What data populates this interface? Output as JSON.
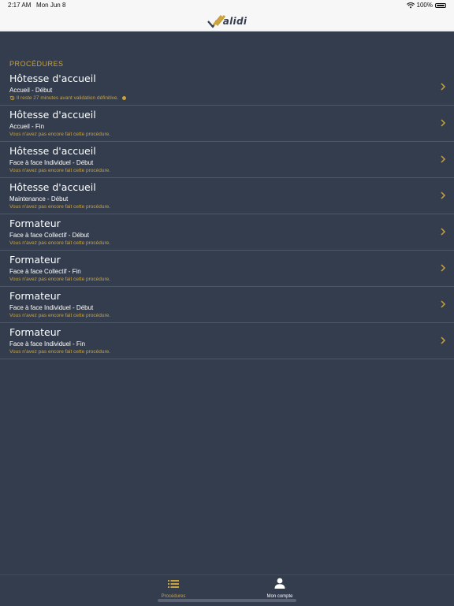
{
  "status_bar": {
    "time": "2:17 AM",
    "date": "Mon Jun 8",
    "battery": "100%"
  },
  "app": {
    "logo_text": "alidi"
  },
  "section_title": "PROCÉDURES",
  "procedures": [
    {
      "title": "Hôtesse d'accueil",
      "subtitle": "Accueil - Début",
      "status": "Il reste 27 minutes avant validation définitive."
    },
    {
      "title": "Hôtesse d'accueil",
      "subtitle": "Accueil - Fin",
      "status": "Vous n'avez pas encore fait cette procédure."
    },
    {
      "title": "Hôtesse d'accueil",
      "subtitle": "Face à face Individuel - Début",
      "status": "Vous n'avez pas encore fait cette procédure."
    },
    {
      "title": "Hôtesse d'accueil",
      "subtitle": "Maintenance - Début",
      "status": "Vous n'avez pas encore fait cette procédure."
    },
    {
      "title": "Formateur",
      "subtitle": "Face à face Collectif - Début",
      "status": "Vous n'avez pas encore fait cette procédure."
    },
    {
      "title": "Formateur",
      "subtitle": "Face à face Collectif - Fin",
      "status": "Vous n'avez pas encore fait cette procédure."
    },
    {
      "title": "Formateur",
      "subtitle": "Face à face Individuel - Début",
      "status": "Vous n'avez pas encore fait cette procédure."
    },
    {
      "title": "Formateur",
      "subtitle": "Face à face Individuel - Fin",
      "status": "Vous n'avez pas encore fait cette procédure."
    }
  ],
  "tabbar": {
    "procedures_label": "Procédures",
    "account_label": "Mon compte",
    "active_color": "#c9a23b",
    "inactive_color": "#ffffff"
  },
  "colors": {
    "background": "#343d4e",
    "accent": "#c9a23b",
    "header": "#f7f7f7"
  }
}
